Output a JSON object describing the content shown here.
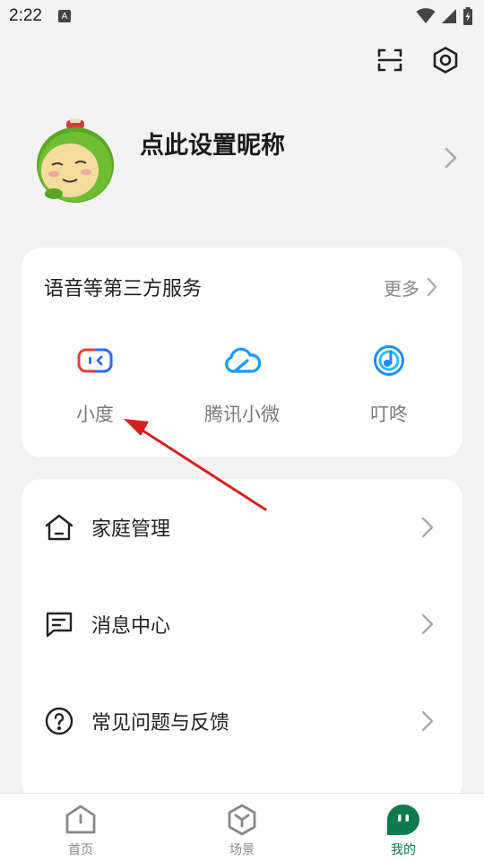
{
  "status_bar": {
    "time": "2:22",
    "notification_icon_letter": "A"
  },
  "profile": {
    "nickname": "点此设置昵称"
  },
  "services": {
    "title": "语音等第三方服务",
    "more_label": "更多",
    "items": [
      {
        "label": "小度",
        "icon": "xiaodu-icon",
        "color": "#2f6bff"
      },
      {
        "label": "腾讯小微",
        "icon": "tencent-xiaowei-icon",
        "color": "#1a9bff"
      },
      {
        "label": "叮咚",
        "icon": "dingdong-icon",
        "color": "#1a8cff"
      }
    ]
  },
  "menu": {
    "items": [
      {
        "label": "家庭管理",
        "icon": "home-icon"
      },
      {
        "label": "消息中心",
        "icon": "message-icon"
      },
      {
        "label": "常见问题与反馈",
        "icon": "help-icon"
      }
    ]
  },
  "bottom_nav": {
    "items": [
      {
        "label": "首页",
        "icon": "home-tab-icon",
        "active": false
      },
      {
        "label": "场景",
        "icon": "scene-tab-icon",
        "active": false
      },
      {
        "label": "我的",
        "icon": "profile-tab-icon",
        "active": true
      }
    ]
  },
  "colors": {
    "accent": "#0f7a4d",
    "annotation_arrow": "#d42020",
    "background": "#f3f3f3",
    "card": "#ffffff"
  }
}
